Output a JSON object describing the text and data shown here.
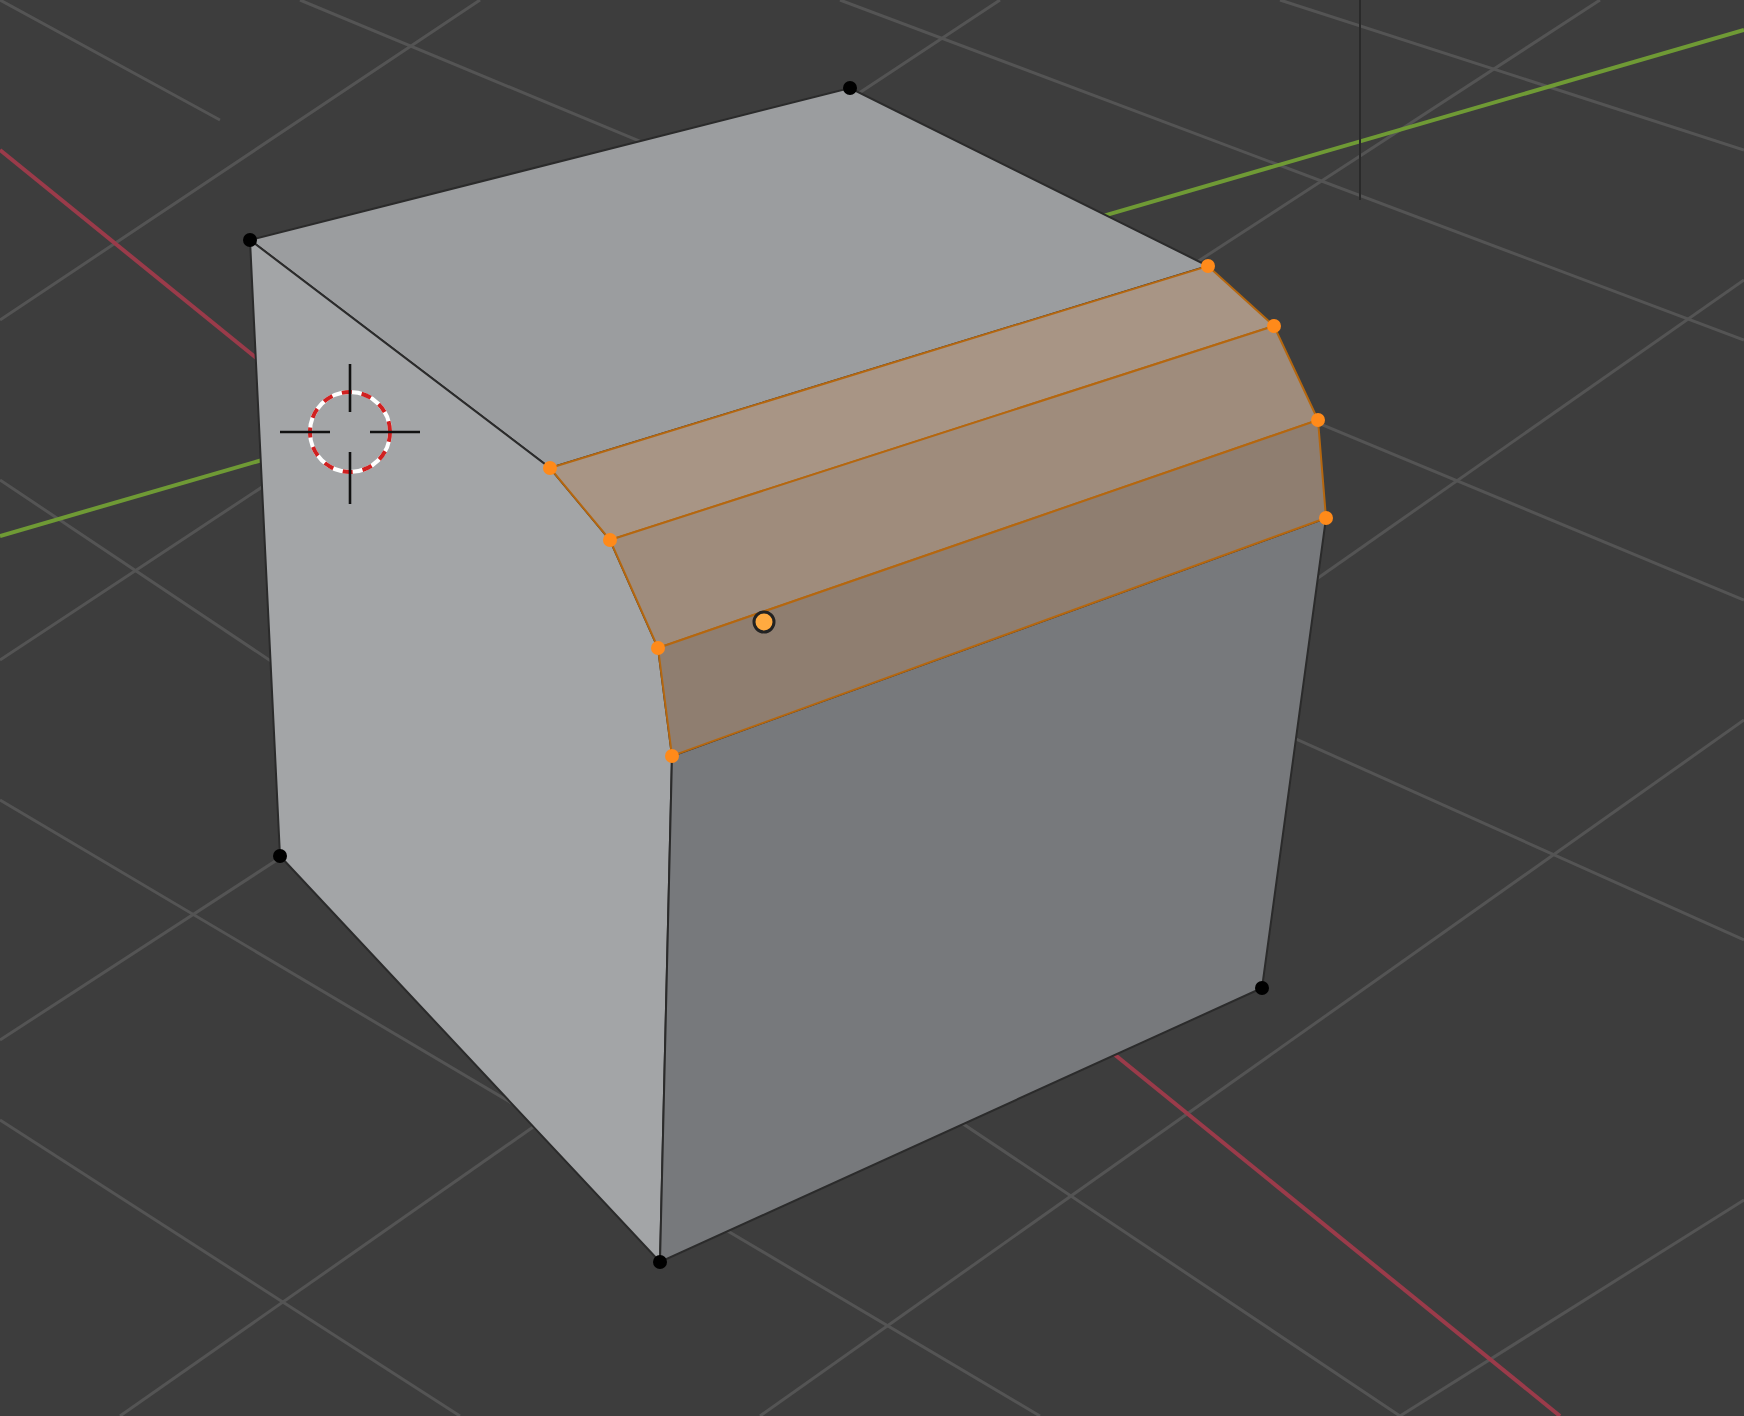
{
  "viewport": {
    "vertices": [
      {
        "selected": false
      },
      {
        "selected": false
      },
      {
        "selected": false
      },
      {
        "selected": false
      },
      {
        "selected": false
      },
      {
        "selected": true
      },
      {
        "selected": true
      },
      {
        "selected": true
      },
      {
        "selected": true
      },
      {
        "selected": true
      },
      {
        "selected": true
      },
      {
        "selected": true
      },
      {
        "selected": true
      }
    ]
  }
}
